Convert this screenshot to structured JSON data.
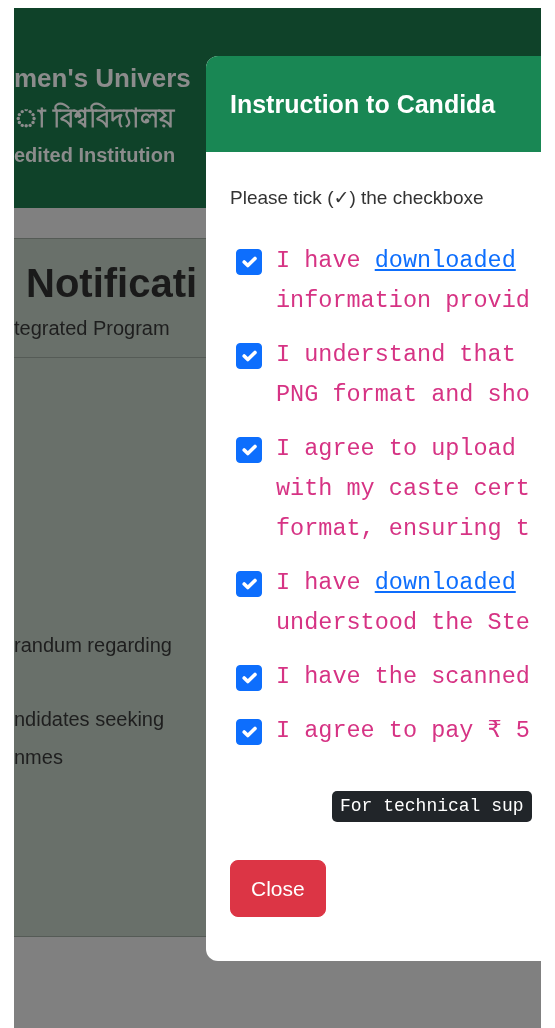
{
  "header": {
    "lines": [
      {
        "text": "men's Univers",
        "kind": "name"
      },
      {
        "text": "া বিশ্ববিদ্যালয়",
        "kind": "name"
      },
      {
        "text": "edited Institution",
        "kind": "tagline"
      }
    ]
  },
  "notice": {
    "title": "Notificati",
    "subtitle": "tegrated Program",
    "items": [
      {
        "lines": [
          "randum regarding"
        ]
      },
      {
        "lines": [
          "ndidates seeking",
          "nmes"
        ]
      }
    ]
  },
  "modal": {
    "title": "Instruction to Candida",
    "intro": "Please tick (✓) the checkboxe",
    "items": [
      {
        "checked": true,
        "lines": [
          [
            {
              "text": "I have ",
              "kind": "text"
            },
            {
              "text": "downloaded",
              "kind": "link"
            }
          ],
          [
            {
              "text": "information provid",
              "kind": "text"
            }
          ]
        ]
      },
      {
        "checked": true,
        "lines": [
          [
            {
              "text": "I understand that",
              "kind": "text"
            }
          ],
          [
            {
              "text": "PNG format and sho",
              "kind": "text"
            }
          ]
        ]
      },
      {
        "checked": true,
        "lines": [
          [
            {
              "text": "I agree to upload",
              "kind": "text"
            }
          ],
          [
            {
              "text": "with my caste cert",
              "kind": "text"
            }
          ],
          [
            {
              "text": "format, ensuring t",
              "kind": "text"
            }
          ]
        ]
      },
      {
        "checked": true,
        "lines": [
          [
            {
              "text": "I have ",
              "kind": "text"
            },
            {
              "text": "downloaded",
              "kind": "link"
            }
          ],
          [
            {
              "text": "understood the Ste",
              "kind": "text"
            }
          ]
        ]
      },
      {
        "checked": true,
        "lines": [
          [
            {
              "text": "I have the scanned",
              "kind": "text"
            }
          ]
        ]
      },
      {
        "checked": true,
        "lines": [
          [
            {
              "text": "I agree to pay ₹ 5",
              "kind": "text"
            }
          ]
        ]
      }
    ],
    "tooltip": "For technical sup",
    "close": "Close"
  }
}
